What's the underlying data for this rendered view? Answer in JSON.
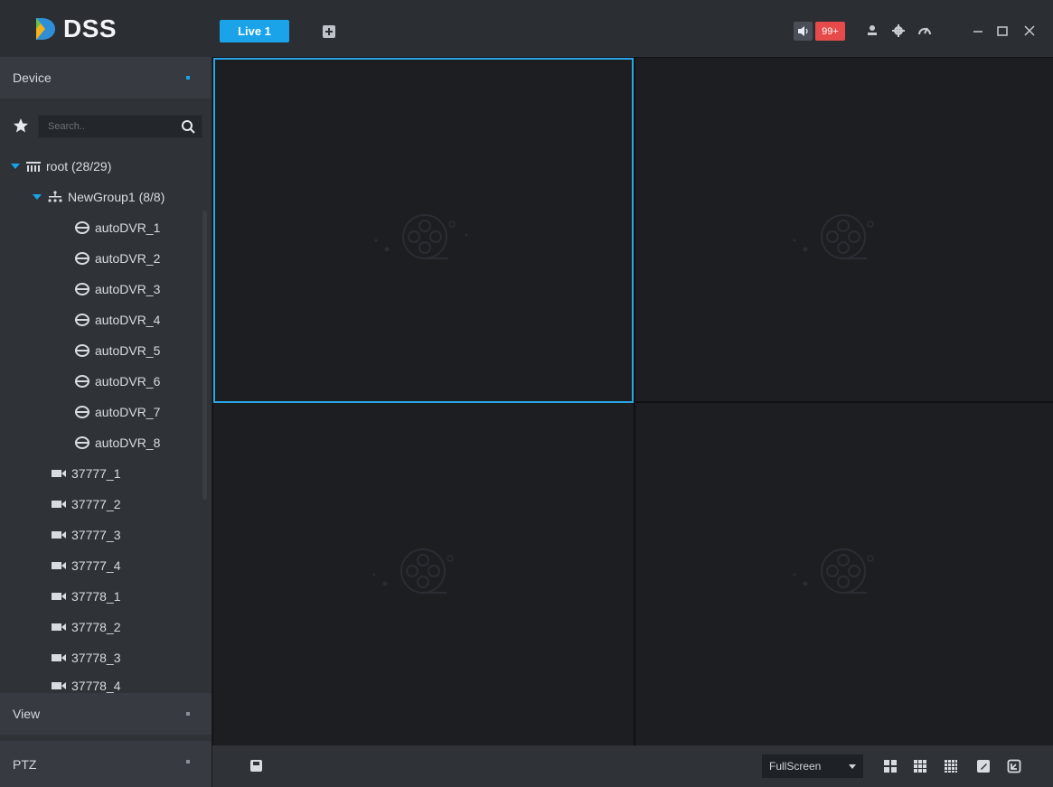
{
  "app": {
    "name": "DSS"
  },
  "tabs": [
    {
      "label": "Live 1"
    }
  ],
  "header": {
    "alarm_badge": "99+"
  },
  "sidebar": {
    "sections": {
      "device": "Device",
      "view": "View",
      "ptz": "PTZ"
    },
    "search": {
      "placeholder": "Search.."
    },
    "tree": {
      "root": "root (28/29)",
      "group": "NewGroup1 (8/8)",
      "group_items": [
        "autoDVR_1",
        "autoDVR_2",
        "autoDVR_3",
        "autoDVR_4",
        "autoDVR_5",
        "autoDVR_6",
        "autoDVR_7",
        "autoDVR_8"
      ],
      "cameras": [
        "37777_1",
        "37777_2",
        "37777_3",
        "37777_4",
        "37778_1",
        "37778_2",
        "37778_3",
        "37778_4"
      ]
    }
  },
  "bottom_bar": {
    "stream_select": "FullScreen"
  },
  "colors": {
    "accent": "#1aa3e8",
    "badge": "#e64a4a",
    "panel": "#2f3237"
  },
  "icons": [
    "app-logo-icon",
    "add-tab-icon",
    "sound-icon",
    "user-icon",
    "settings-icon",
    "performance-icon",
    "minimize-icon",
    "maximize-icon",
    "close-icon",
    "favorites-star-icon",
    "search-icon",
    "root-node-icon",
    "group-node-icon",
    "dvr-device-icon",
    "camera-icon",
    "save-icon",
    "layout-4-icon",
    "layout-9-icon",
    "layout-16-icon",
    "custom-layout-icon",
    "window-fit-icon"
  ]
}
